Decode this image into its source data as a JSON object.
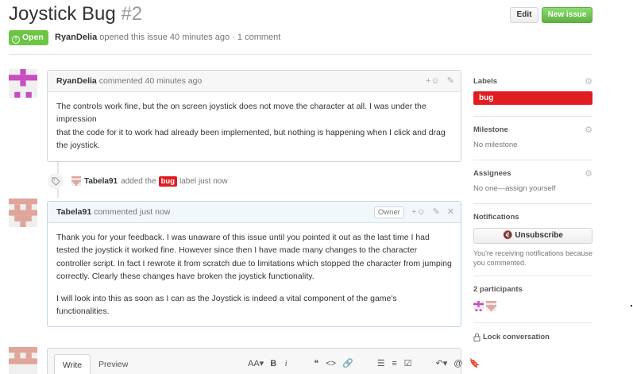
{
  "issue": {
    "title": "Joystick Bug",
    "number": "#2",
    "state": "Open",
    "author": "RyanDelia",
    "meta_text": "opened this issue 40 minutes ago · 1 comment"
  },
  "header_buttons": {
    "edit": "Edit",
    "new_issue": "New issue"
  },
  "comments": [
    {
      "author": "RyanDelia",
      "time": "commented 40 minutes ago",
      "body_line1": "The controls work fine, but the on screen joystick does not move the character at all. I was under the impression",
      "body_line2": "that the code for it to work had already been implemented, but nothing is happening when I click and drag the joystick."
    },
    {
      "author": "Tabela91",
      "time": "commented just now",
      "badge": "Owner",
      "body_p1": "Thank you for your feedback. I was unaware of this issue until you pointed it out as the last time I had tested the joystick it worked fine. However since then I have made many changes to the character controller script. In fact I rewrote it from scratch due to limitations which stopped the character from jumping correctly. Clearly these changes have broken the joystick functionality.",
      "body_p2": "I will look into this as soon as I can as the Joystick is indeed a vital component of the game's functionalities."
    }
  ],
  "event": {
    "actor": "Tabela91",
    "text_before": "added the",
    "label": "bug",
    "text_after": "label just now"
  },
  "composer": {
    "tab_write": "Write",
    "tab_preview": "Preview",
    "toolbar": [
      "AA▾",
      "B",
      "i",
      "❝",
      "<>",
      "🔗",
      "☰",
      "≡",
      "☑",
      "↶▾",
      "@",
      "🔖"
    ]
  },
  "sidebar": {
    "labels_heading": "Labels",
    "label": "bug",
    "milestone_heading": "Milestone",
    "milestone_value": "No milestone",
    "assignees_heading": "Assignees",
    "assignees_value": "No one—assign yourself",
    "notifications_heading": "Notifications",
    "unsubscribe": "Unsubscribe",
    "notif_text": "You're receiving notifications because you commented.",
    "participants_heading": "2 participants",
    "lock": "Lock conversation"
  },
  "colors": {
    "open_green": "#6cc644",
    "bug_red": "#e11d21",
    "avatar_ryan": "#c94cc0",
    "avatar_tabela": "#e0a59a"
  },
  "icons": [
    "gear-icon",
    "emoji-icon",
    "pencil-icon",
    "close-icon",
    "tag-icon",
    "mute-icon",
    "lock-icon",
    "open-issue-icon"
  ]
}
